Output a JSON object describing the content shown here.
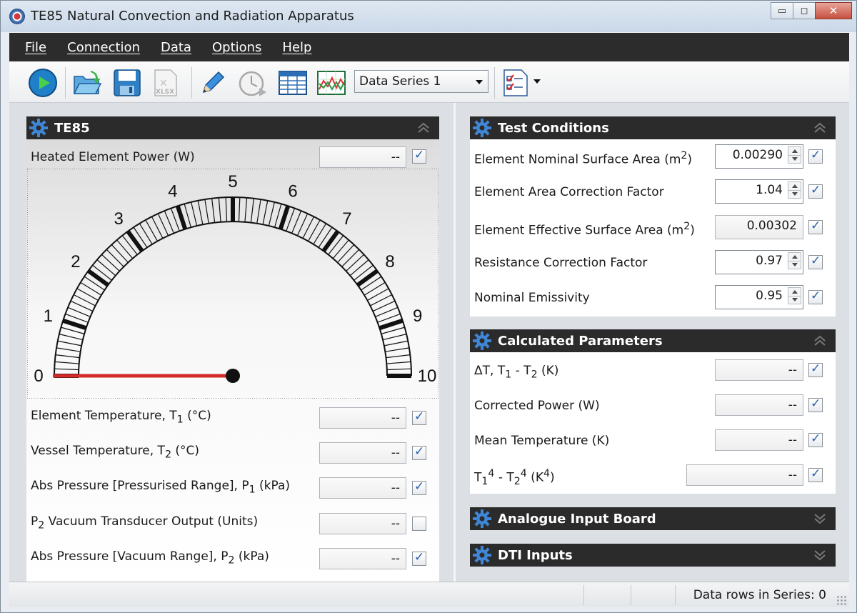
{
  "window": {
    "title": "TE85 Natural Convection and Radiation Apparatus",
    "buttons": {
      "minimize": "▭",
      "maximize": "◻",
      "close": "✕"
    }
  },
  "menu": {
    "items": [
      "File",
      "Connection",
      "Data",
      "Options",
      "Help"
    ]
  },
  "toolbar": {
    "icons": [
      "play-icon",
      "open-folder-icon",
      "save-icon",
      "export-xlsx-icon",
      "pencil-icon",
      "timer-icon",
      "table-icon",
      "chart-icon",
      "checklist-icon"
    ],
    "xlsx_label": "XLSX",
    "series_select": "Data Series 1"
  },
  "te85_panel": {
    "title": "TE85",
    "heated_power": {
      "label": "Heated Element Power  (W)",
      "value": "--",
      "checked": true
    },
    "gauge": {
      "labels": [
        "0",
        "1",
        "2",
        "3",
        "4",
        "5",
        "6",
        "7",
        "8",
        "9",
        "10"
      ],
      "min": 0,
      "max": 10,
      "value": 0,
      "needle_color": "#d42a2a"
    },
    "rows": [
      {
        "label_main": "Element Temperature, T",
        "sub": "1",
        "unit": "  (°C)",
        "value": "--",
        "checked": true
      },
      {
        "label_main": "Vessel Temperature, T",
        "sub": "2",
        "unit": "  (°C)",
        "value": "--",
        "checked": true
      },
      {
        "label_main": "Abs Pressure [Pressurised Range], P",
        "sub": "1",
        "unit": "  (kPa)",
        "value": "--",
        "checked": true
      },
      {
        "label_pre": "P",
        "sub": "2",
        "label_main": " Vacuum Transducer Output  (Units)",
        "value": "--",
        "checked": false
      },
      {
        "label_main": "Abs Pressure [Vacuum Range], P",
        "sub": "2",
        "unit": "  (kPa)",
        "value": "--",
        "checked": true
      }
    ]
  },
  "test_conditions": {
    "title": "Test Conditions",
    "rows": [
      {
        "label": "Element Nominal Surface Area  (m",
        "sup": "2",
        "tail": ")",
        "value": "0.00290",
        "editable": true,
        "checked": true
      },
      {
        "label": "Element Area Correction Factor",
        "value": "1.04",
        "editable": true,
        "checked": true
      },
      {
        "label": "Element Effective Surface Area  (m",
        "sup": "2",
        "tail": ")",
        "value": "0.00302",
        "editable": false,
        "checked": true
      },
      {
        "label": "Resistance Correction Factor",
        "value": "0.97",
        "editable": true,
        "checked": true
      },
      {
        "label": "Nominal Emissivity",
        "value": "0.95",
        "editable": true,
        "checked": true
      }
    ]
  },
  "calculated": {
    "title": "Calculated Parameters",
    "dt": {
      "p1": "ΔT, T",
      "s1": "1",
      "p2": " - T",
      "s2": "2",
      "p3": "  (K)",
      "value": "--"
    },
    "power": {
      "label": "Corrected Power  (W)",
      "value": "--"
    },
    "mean": {
      "label": "Mean Temperature  (K)",
      "value": "--"
    },
    "t4": {
      "p1": "T",
      "s1": "1",
      "sup1": "4",
      "p2": " - T",
      "s2": "2",
      "sup2": "4",
      "p3": "  (K",
      "sup3": "4",
      "p4": ")",
      "value": "--"
    }
  },
  "analogue": {
    "title": "Analogue Input Board"
  },
  "dti": {
    "title": "DTI Inputs"
  },
  "status": {
    "text": "Data rows in Series: 0"
  }
}
